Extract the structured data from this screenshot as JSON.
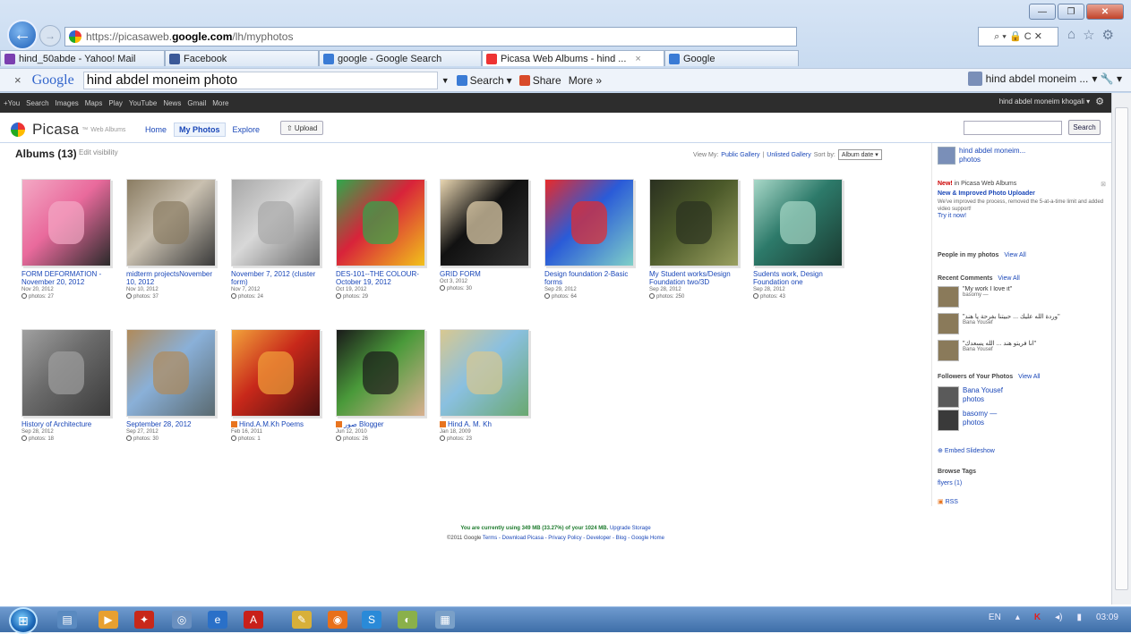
{
  "browser": {
    "url_scheme": "https://picasaweb.",
    "url_host": "google.com",
    "url_path": "/lh/myphotos",
    "addr_right": "⌕ ▾ 🔒 C ✕",
    "tabs": [
      {
        "label": "hind_50abde - Yahoo! Mail",
        "color": "#7b3fb0"
      },
      {
        "label": "Facebook",
        "color": "#3b5998"
      },
      {
        "label": "google - Google Search",
        "color": "#3a7bd5"
      },
      {
        "label": "Picasa Web Albums - hind ...",
        "color": "#e33"
      },
      {
        "label": "Google",
        "color": "#3a7bd5"
      }
    ],
    "tab_close": "×"
  },
  "google_toolbar": {
    "close": "×",
    "logo": "Google",
    "query": "hind abdel moneim photo",
    "search_label": "Search",
    "share_label": "Share",
    "more_label": "More »",
    "user_label": "hind abdel moneim ..."
  },
  "gbar": {
    "links": [
      "+You",
      "Search",
      "Images",
      "Maps",
      "Play",
      "YouTube",
      "News",
      "Gmail",
      "More"
    ],
    "user": "hind abdel moneim khogali ▾"
  },
  "picasa": {
    "logo": "Picasa",
    "logo_sub": "Web Albums",
    "tabs": [
      "Home",
      "My Photos",
      "Explore"
    ],
    "upload": "⇧ Upload",
    "search_button": "Search",
    "albums_title": "Albums (13)",
    "edit_visibility": "Edit visibility",
    "view_my": "View My:",
    "public_gallery": "Public Gallery",
    "sep": "|",
    "unlisted_gallery": "Unlisted Gallery",
    "sort_by": "Sort by:",
    "sort_value": "Album date ▾"
  },
  "albums": [
    {
      "title": "FORM DEFORMATION - November 20, 2012",
      "date": "Nov 20, 2012",
      "count": "photos: 27",
      "colors": [
        "#e96a9c",
        "#f3a8c4",
        "#2a2a2a"
      ]
    },
    {
      "title": "midterm projectsNovember 10, 2012",
      "date": "Nov 10, 2012",
      "count": "photos: 37",
      "colors": [
        "#c9c0b0",
        "#8a7c62",
        "#3a3a3a"
      ]
    },
    {
      "title": "November 7, 2012 (cluster form)",
      "date": "Nov 7, 2012",
      "count": "photos: 24",
      "colors": [
        "#d8d8d8",
        "#a8a8a8",
        "#6a6a6a"
      ]
    },
    {
      "title": "DES-101--THE COLOUR-October 19, 2012",
      "date": "Oct 19, 2012",
      "count": "photos: 29",
      "colors": [
        "#d8233a",
        "#2fa84b",
        "#f2c21a"
      ]
    },
    {
      "title": "GRID FORM",
      "date": "Oct 3, 2012",
      "count": "photos: 30",
      "colors": [
        "#111111",
        "#e8d5b0",
        "#333333"
      ]
    },
    {
      "title": "Design foundation 2-Basic forms",
      "date": "Sep 29, 2012",
      "count": "photos: 64",
      "colors": [
        "#2a5bd8",
        "#e82a2a",
        "#7fd0c8"
      ]
    },
    {
      "title": "My Student works/Design Foundation two/3D",
      "date": "Sep 28, 2012",
      "count": "photos: 250",
      "colors": [
        "#4c5a2a",
        "#2a3020",
        "#9aa060"
      ]
    },
    {
      "title": "Sudents work, Design Foundation one",
      "date": "Sep 28, 2012",
      "count": "photos: 43",
      "colors": [
        "#2d7a6a",
        "#a8d8c8",
        "#1a3a30"
      ]
    },
    {
      "title": "History of Architecture",
      "date": "Sep 28, 2012",
      "count": "photos: 18",
      "colors": [
        "#6a6a6a",
        "#a0a0a0",
        "#3a3a3a"
      ]
    },
    {
      "title": "September 28, 2012",
      "date": "Sep 27, 2012",
      "count": "photos: 30",
      "colors": [
        "#8ab0d8",
        "#b08a5a",
        "#5a6a70"
      ]
    },
    {
      "title": "Hind.A.M.Kh Poems",
      "date": "Feb 16, 2011",
      "count": "photos: 1",
      "colors": [
        "#c8281a",
        "#f2a23a",
        "#4a1010"
      ]
    },
    {
      "title": "صور Blogger",
      "date": "Jun 12, 2010",
      "count": "photos: 26",
      "colors": [
        "#4a9a3a",
        "#1a1a1a",
        "#d8b090"
      ]
    },
    {
      "title": "Hind A. M. Kh",
      "date": "Jan 18, 2009",
      "count": "photos: 23",
      "colors": [
        "#8ac0e0",
        "#d8c890",
        "#6aa870"
      ]
    }
  ],
  "sidebar": {
    "user_name": "hind abdel moneim...",
    "user_photos": "photos",
    "new_label": "New!",
    "new_heading": "in Picasa Web Albums",
    "new_link": "New & Improved Photo Uploader",
    "new_text": "We've improved the process, removed the 5-at-a-time limit and added video support!",
    "try_it": "Try it now!",
    "people_heading": "People in my photos",
    "view_all": "View All",
    "recent_comments": "Recent Comments",
    "comments": [
      {
        "text": "\"My work I love it\"",
        "author": "basomy —"
      },
      {
        "text": "\"وردة الله عليك ... حبيتنا بفرحة يا هند\"",
        "author": "Bana Yousef"
      },
      {
        "text": "\"انا فريتو هند ... الله يسعدك\"",
        "author": "Bana Yousef"
      }
    ],
    "followers_heading": "Followers of Your Photos",
    "followers": [
      {
        "name": "Bana Yousef",
        "link": "photos"
      },
      {
        "name": "basomy —",
        "link": "photos"
      }
    ],
    "embed": "Embed Slideshow",
    "browse_tags": "Browse Tags",
    "tag": "flyers (1)",
    "rss": "RSS"
  },
  "footer": {
    "usage": "You are currently using 349 MB (33.27%) of your 1024 MB.",
    "upgrade": "Upgrade Storage",
    "copyright": "©2011 Google",
    "links": "Terms - Download Picasa - Privacy Policy - Developer - Blog - Google Home"
  },
  "taskbar": {
    "lang": "EN",
    "time": "03:09"
  }
}
